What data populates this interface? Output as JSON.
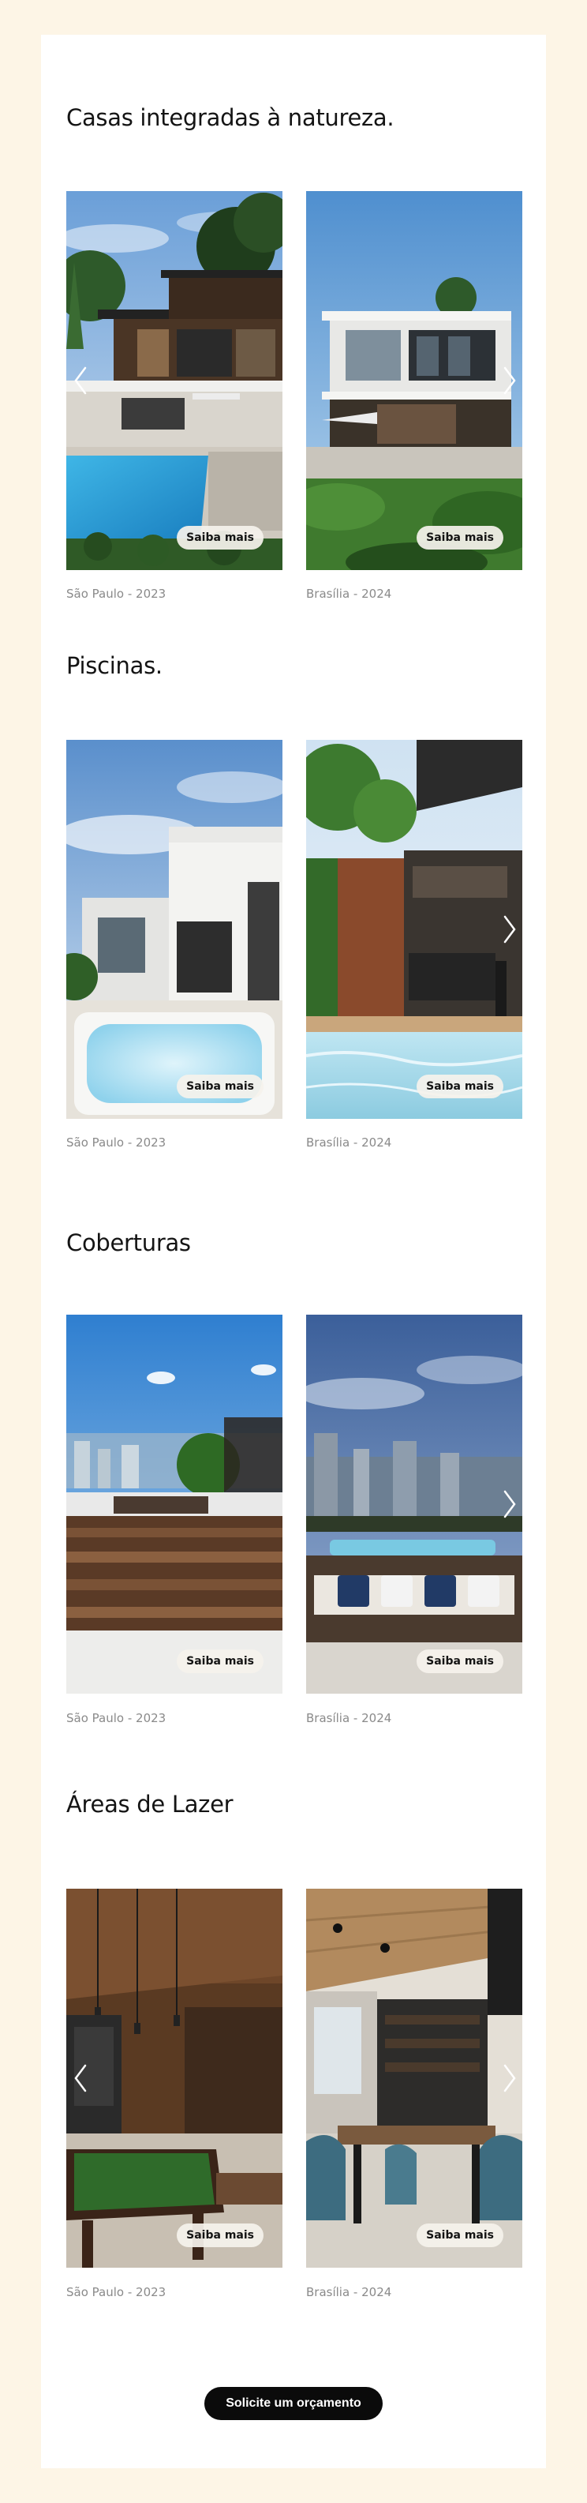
{
  "sections": [
    {
      "title": "Casas integradas à natureza.",
      "projects": [
        {
          "caption": "São Paulo - 2023",
          "button": "Saiba mais"
        },
        {
          "caption": "Brasília - 2024",
          "button": "Saiba mais"
        }
      ]
    },
    {
      "title": "Piscinas.",
      "projects": [
        {
          "caption": "São Paulo - 2023",
          "button": "Saiba mais"
        },
        {
          "caption": "Brasília - 2024",
          "button": "Saiba mais"
        }
      ]
    },
    {
      "title": "Coberturas",
      "projects": [
        {
          "caption": "São Paulo - 2023",
          "button": "Saiba mais"
        },
        {
          "caption": "Brasília - 2024",
          "button": "Saiba mais"
        }
      ]
    },
    {
      "title": "Áreas de Lazer",
      "projects": [
        {
          "caption": "São Paulo - 2023",
          "button": "Saiba mais"
        },
        {
          "caption": "Brasília - 2024",
          "button": "Saiba mais"
        }
      ]
    }
  ],
  "cta": {
    "label": "Solicite um orçamento"
  },
  "icons": {
    "prev": "chevron-left-icon",
    "next": "chevron-right-icon"
  },
  "colors": {
    "page_background": "#fdf5e6",
    "card_background": "#ffffff",
    "cta_background": "#0b0b0b",
    "caption_text": "#8a8a8a"
  }
}
